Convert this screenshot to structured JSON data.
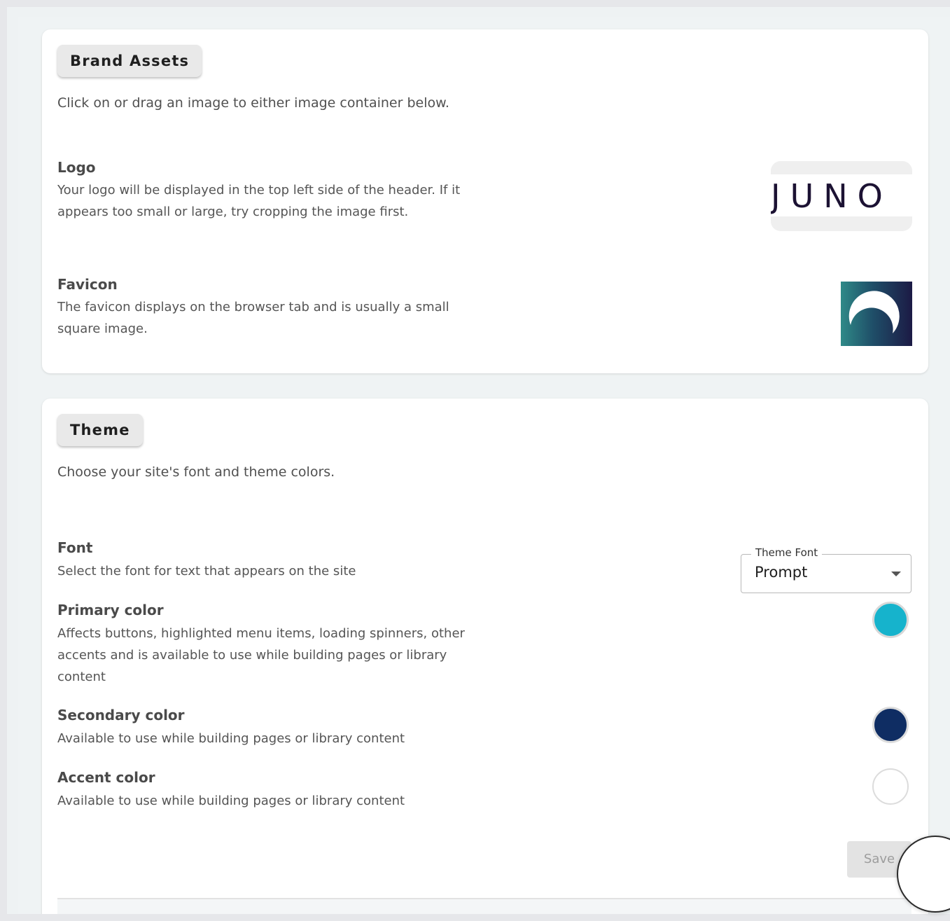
{
  "brand_assets": {
    "title": "Brand Assets",
    "intro": "Click on or drag an image to either image container below.",
    "logo": {
      "title": "Logo",
      "description": "Your logo will be displayed in the top left side of the header. If it appears too small or large, try cropping the image first.",
      "preview_text": "JUNO"
    },
    "favicon": {
      "title": "Favicon",
      "description": "The favicon displays on the browser tab and is usually a small square image."
    }
  },
  "theme": {
    "title": "Theme",
    "intro": "Choose your site's font and theme colors.",
    "font": {
      "title": "Font",
      "description": "Select the font for text that appears on the site",
      "select_label": "Theme Font",
      "select_value": "Prompt"
    },
    "primary_color": {
      "title": "Primary color",
      "description": "Affects buttons, highlighted menu items, loading spinners, other accents and is available to use while building pages or library content",
      "color": "#16b3cc"
    },
    "secondary_color": {
      "title": "Secondary color",
      "description": "Available to use while building pages or library content",
      "color": "#0f2d63"
    },
    "accent_color": {
      "title": "Accent color",
      "description": "Available to use while building pages or library content",
      "color": "#ffffff"
    },
    "save_label": "Save"
  }
}
